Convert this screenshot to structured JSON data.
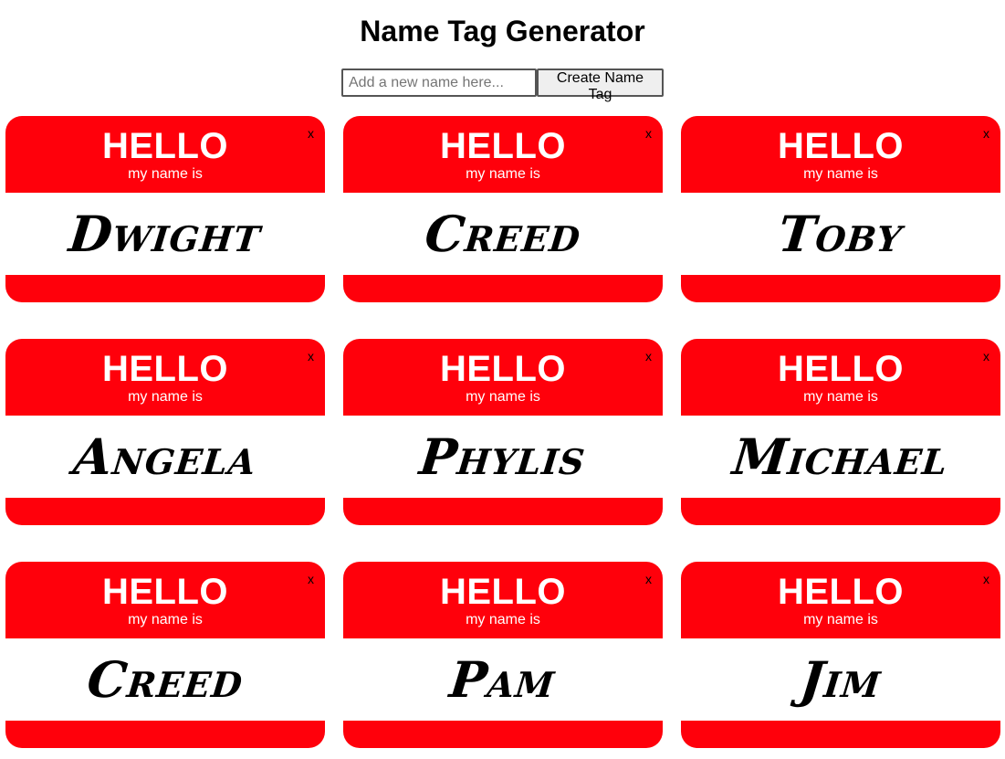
{
  "header": {
    "title": "Name Tag Generator"
  },
  "form": {
    "placeholder": "Add a new name here...",
    "value": "",
    "button_label": "Create Name Tag"
  },
  "tag_template": {
    "hello": "HELLO",
    "subtitle": "my name is",
    "close": "x"
  },
  "colors": {
    "tag_red": "#ff000b",
    "tag_body": "#ffffff"
  },
  "tags": [
    {
      "name": "Dwight"
    },
    {
      "name": "Creed"
    },
    {
      "name": "Toby"
    },
    {
      "name": "Angela"
    },
    {
      "name": "Phylis"
    },
    {
      "name": "Michael"
    },
    {
      "name": "Creed"
    },
    {
      "name": "Pam"
    },
    {
      "name": "Jim"
    }
  ]
}
